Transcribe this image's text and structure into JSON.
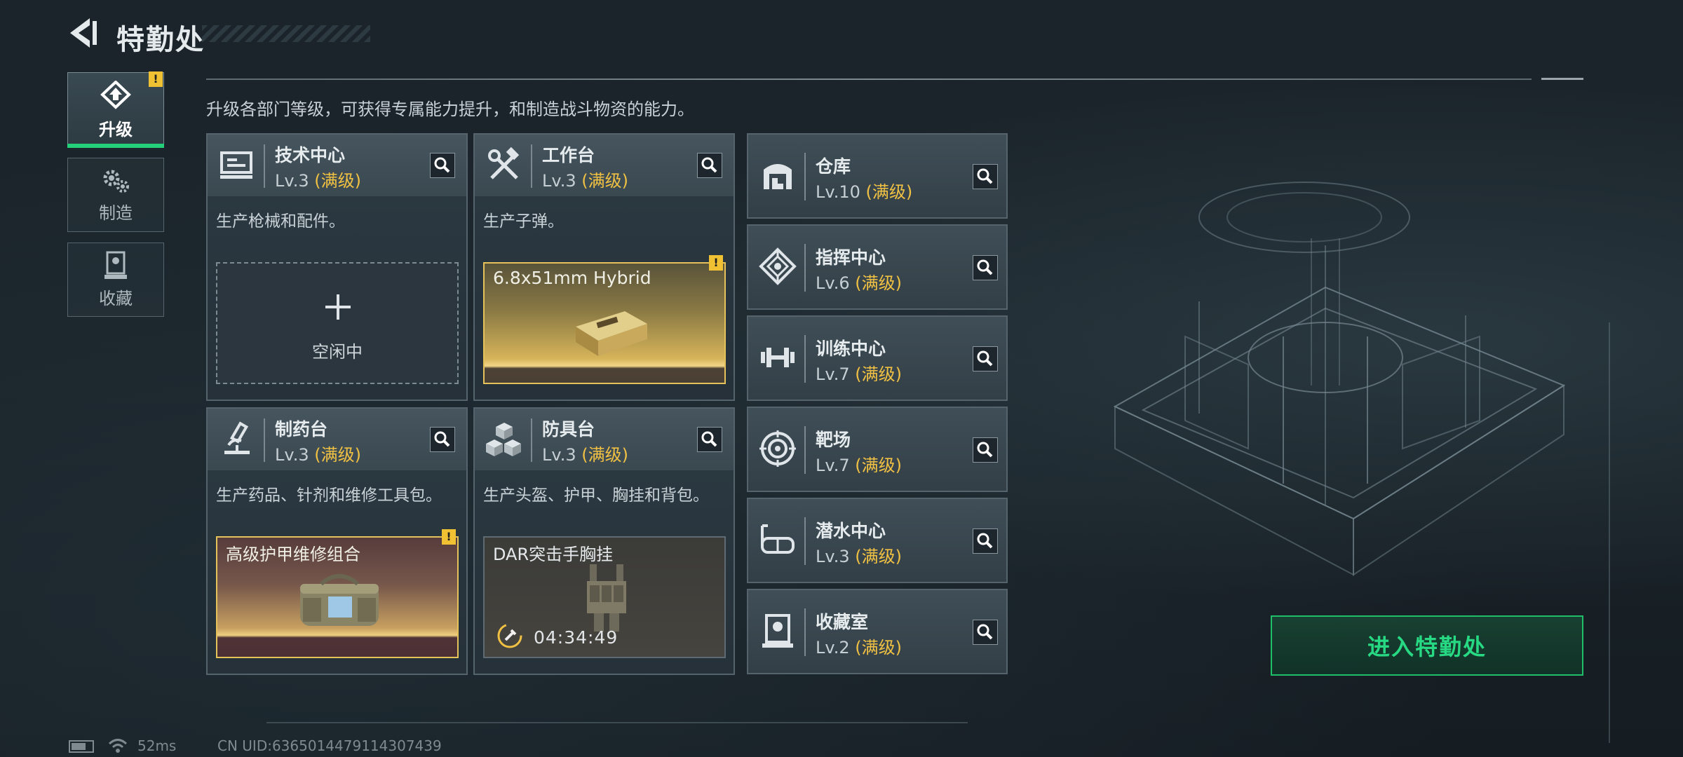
{
  "header": {
    "title": "特勤处"
  },
  "side_nav": {
    "upgrade": "升级",
    "craft": "制造",
    "collection": "收藏",
    "alert_mark": "!"
  },
  "description": "升级各部门等级，可获得专属能力提升，和制造战斗物资的能力。",
  "max_label": "(满级)",
  "departments": [
    {
      "name": "技术中心",
      "level": "Lv.3",
      "desc": "生产枪械和配件。",
      "slot_status": "空闲中",
      "icon": "computer-icon"
    },
    {
      "name": "工作台",
      "level": "Lv.3",
      "desc": "生产子弹。",
      "slot_item": "6.8x51mm Hybrid",
      "icon": "tools-icon"
    },
    {
      "name": "制药台",
      "level": "Lv.3",
      "desc": "生产药品、针剂和维修工具包。",
      "slot_item": "高级护甲维修组合",
      "icon": "microscope-icon"
    },
    {
      "name": "防具台",
      "level": "Lv.3",
      "desc": "生产头盔、护甲、胸挂和背包。",
      "slot_item": "DAR突击手胸挂",
      "slot_timer": "04:34:49",
      "icon": "armor-boxes-icon"
    }
  ],
  "small_departments": [
    {
      "name": "仓库",
      "level": "Lv.10",
      "icon": "warehouse-icon"
    },
    {
      "name": "指挥中心",
      "level": "Lv.6",
      "icon": "command-icon"
    },
    {
      "name": "训练中心",
      "level": "Lv.7",
      "icon": "dumbbell-icon"
    },
    {
      "name": "靶场",
      "level": "Lv.7",
      "icon": "target-icon"
    },
    {
      "name": "潜水中心",
      "level": "Lv.3",
      "icon": "diving-mask-icon"
    },
    {
      "name": "收藏室",
      "level": "Lv.2",
      "icon": "trophy-room-icon"
    }
  ],
  "enter_button": "进入特勤处",
  "status_bar": {
    "ping": "52ms",
    "uid": "CN UID:6365014479114307439"
  },
  "colors": {
    "accent_green": "#25d07a",
    "max_gold": "#f1c143",
    "alert_yellow": "#f0c233"
  }
}
